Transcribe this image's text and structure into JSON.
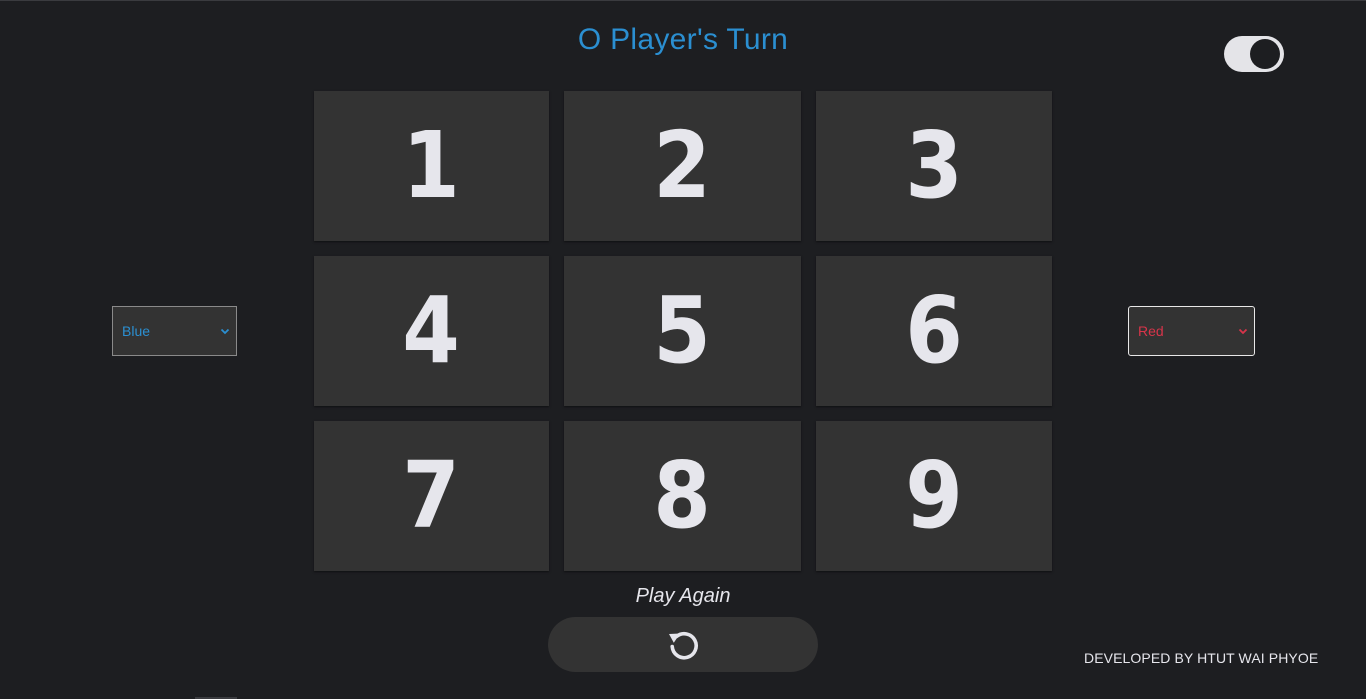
{
  "header": {
    "turn_text": "O Player's Turn",
    "theme_toggle_state": "on"
  },
  "board": {
    "cells": [
      "1",
      "2",
      "3",
      "4",
      "5",
      "6",
      "7",
      "8",
      "9"
    ]
  },
  "player_o_color": {
    "selected": "Blue",
    "color": "#2b8fd1"
  },
  "player_x_color": {
    "selected": "Red",
    "color": "#d8344a"
  },
  "controls": {
    "play_again_label": "Play Again",
    "reset_icon": "rotate-ccw-icon"
  },
  "footer": {
    "credit": "DEVELOPED BY HTUT WAI PHYOE"
  }
}
